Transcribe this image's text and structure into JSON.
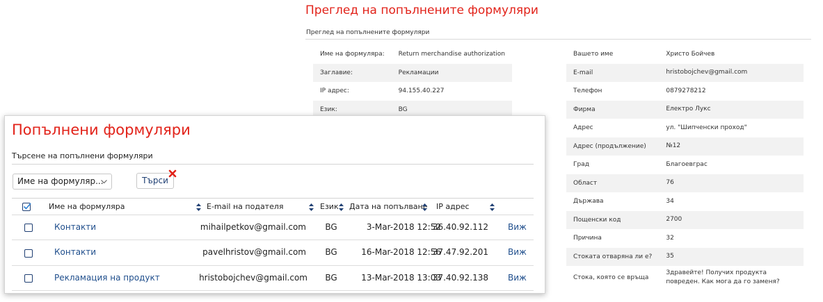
{
  "detail": {
    "title": "Преглед на попълнените формуляри",
    "breadcrumb": "Преглед на попълнените формуляри",
    "left_fields": [
      {
        "label": "Име на формуляра:",
        "value": "Return merchandise authorization"
      },
      {
        "label": "Заглавие:",
        "value": "Рекламации"
      },
      {
        "label": "IP адрес:",
        "value": "94.155.40.227"
      },
      {
        "label": "Език:",
        "value": "BG"
      }
    ],
    "right_fields": [
      {
        "label": "Вашето име",
        "value": "Христо Бойчев"
      },
      {
        "label": "E-mail",
        "value": "hristobojchev@gmail.com"
      },
      {
        "label": "Телефон",
        "value": "0879278212"
      },
      {
        "label": "Фирма",
        "value": "Електро Лукс"
      },
      {
        "label": "Адрес",
        "value": "ул. \"Шипченски проход\""
      },
      {
        "label": "Адрес (продължение)",
        "value": "№12"
      },
      {
        "label": "Град",
        "value": "Благоевграс"
      },
      {
        "label": "Област",
        "value": "76"
      },
      {
        "label": "Държава",
        "value": "34"
      },
      {
        "label": "Пощенски код",
        "value": "2700"
      },
      {
        "label": "Причина",
        "value": "32"
      },
      {
        "label": "Стоката отваряна ли е?",
        "value": "35"
      },
      {
        "label": "Стока, която се връща",
        "value": "Здравейте! Получих продукта повреден. Как мога да го заменя?"
      }
    ]
  },
  "panel": {
    "title": "Попълнени формуляри",
    "subtitle": "Търсене на попълнени формуляри",
    "filter_select_value": "Име на формуляр...",
    "search_label": "Търси",
    "columns": {
      "form_name": "Име на формуляра",
      "email": "E-mail на подателя",
      "lang": "Език",
      "date": "Дата на попълване",
      "ip": "IP адрес"
    },
    "rows": [
      {
        "form_name": "Контакти",
        "email": "mihailpetkov@gmail.com",
        "lang": "BG",
        "date": "3-Mar-2018 12:52",
        "ip": "36.40.92.112",
        "action": "Виж"
      },
      {
        "form_name": "Контакти",
        "email": "pavelhristov@gmail.com",
        "lang": "BG",
        "date": "16-Mar-2018 12:56",
        "ip": "37.47.92.201",
        "action": "Виж"
      },
      {
        "form_name": "Рекламация на продукт",
        "email": "hristobojchev@gmail.com",
        "lang": "BG",
        "date": "13-Mar-2018 13:03",
        "ip": "37.40.92.138",
        "action": "Виж"
      }
    ]
  },
  "colors": {
    "title_red": "#e2231a",
    "link_blue": "#1f4e8c",
    "stripe_gray": "#f2f2f2"
  },
  "icons": [
    "chevron-down-icon",
    "clear-icon",
    "sort-icon",
    "checkbox-checked-icon"
  ]
}
